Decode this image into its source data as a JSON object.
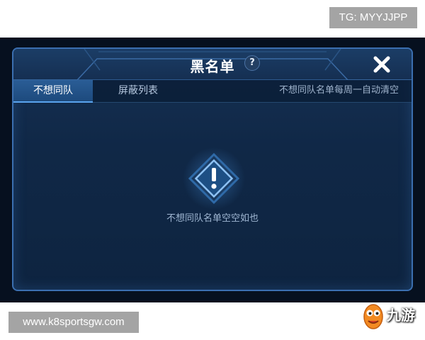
{
  "overlay": {
    "tg_label": "TG: MYYJJPP",
    "site_label": "www.k8sportsgw.com"
  },
  "dialog": {
    "title": "黑名单",
    "help_glyph": "?",
    "close_icon": "close-icon"
  },
  "tabs": [
    {
      "label": "不想同队",
      "active": true
    },
    {
      "label": "屏蔽列表",
      "active": false
    }
  ],
  "tab_note": "不想同队名单每周一自动清空",
  "empty_state": {
    "icon": "warning-icon",
    "text": "不想同队名单空空如也"
  },
  "watermark": {
    "text": "九游",
    "icon": "mascot-icon"
  },
  "colors": {
    "accent": "#5aa4ee",
    "panel": "#102847",
    "border": "#3b6fb0"
  }
}
